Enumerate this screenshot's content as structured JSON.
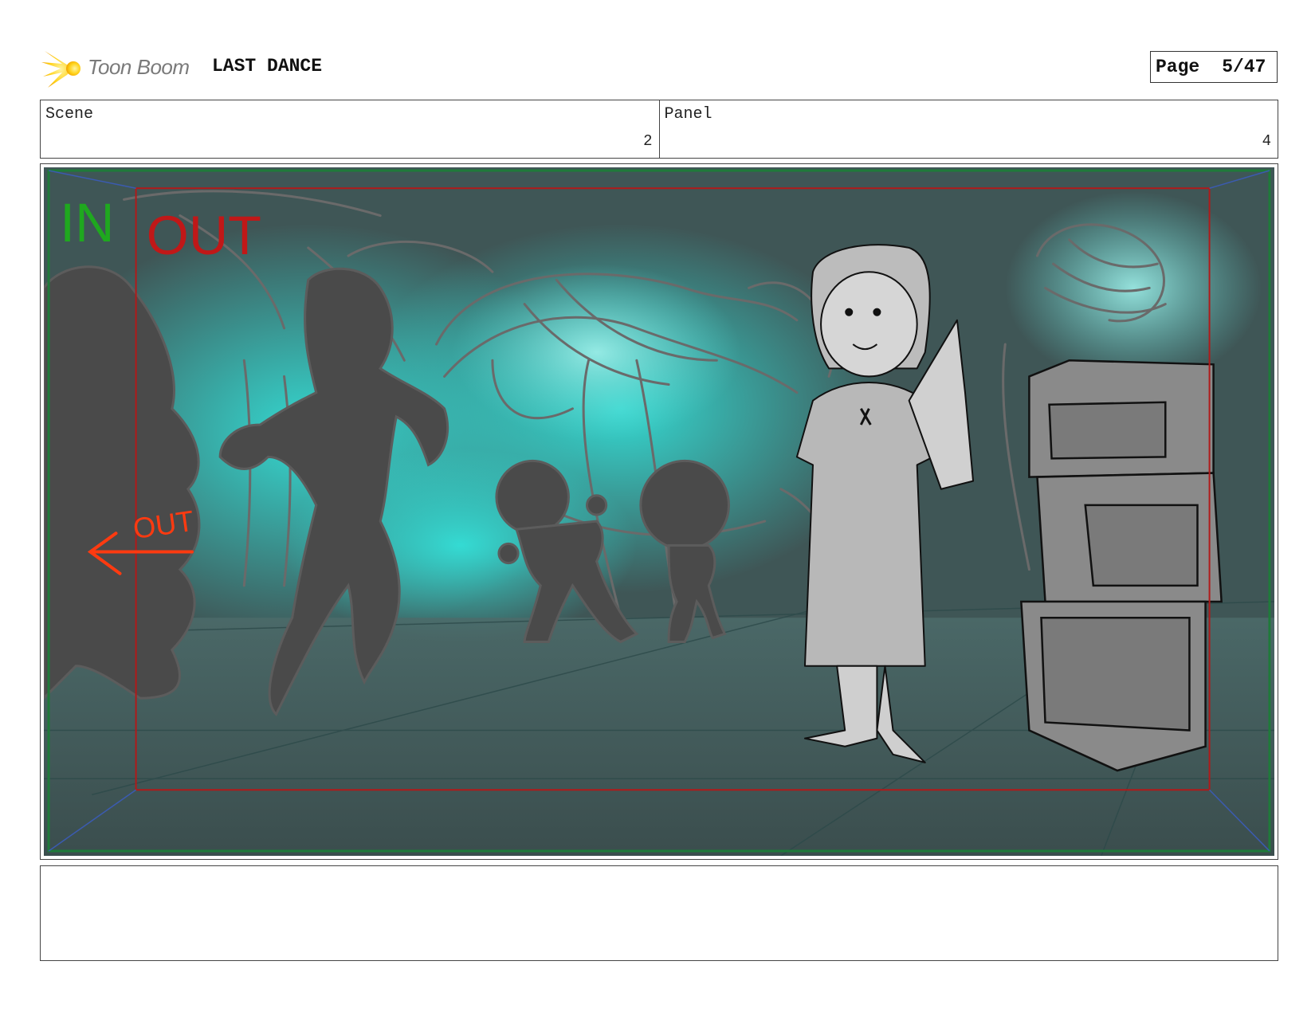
{
  "header": {
    "logo_icon": "toon-boom-star-icon",
    "logo_text": "Toon Boom",
    "project_title": "LAST DANCE",
    "page_label": "Page",
    "page_value": "5/47"
  },
  "scene": {
    "label": "Scene",
    "value": "2"
  },
  "panel": {
    "label": "Panel",
    "value": "4"
  },
  "image": {
    "in_label": "IN",
    "out_label": "OUT",
    "arrow_label": "OUT",
    "colors": {
      "in": "#1fa81f",
      "out": "#c01818",
      "arrow": "#ff3a10",
      "background_glow": "#2fd6cf",
      "background_dark": "#3a4a4a",
      "silhouette": "#4a4a4a"
    }
  },
  "notes": {
    "text": ""
  }
}
